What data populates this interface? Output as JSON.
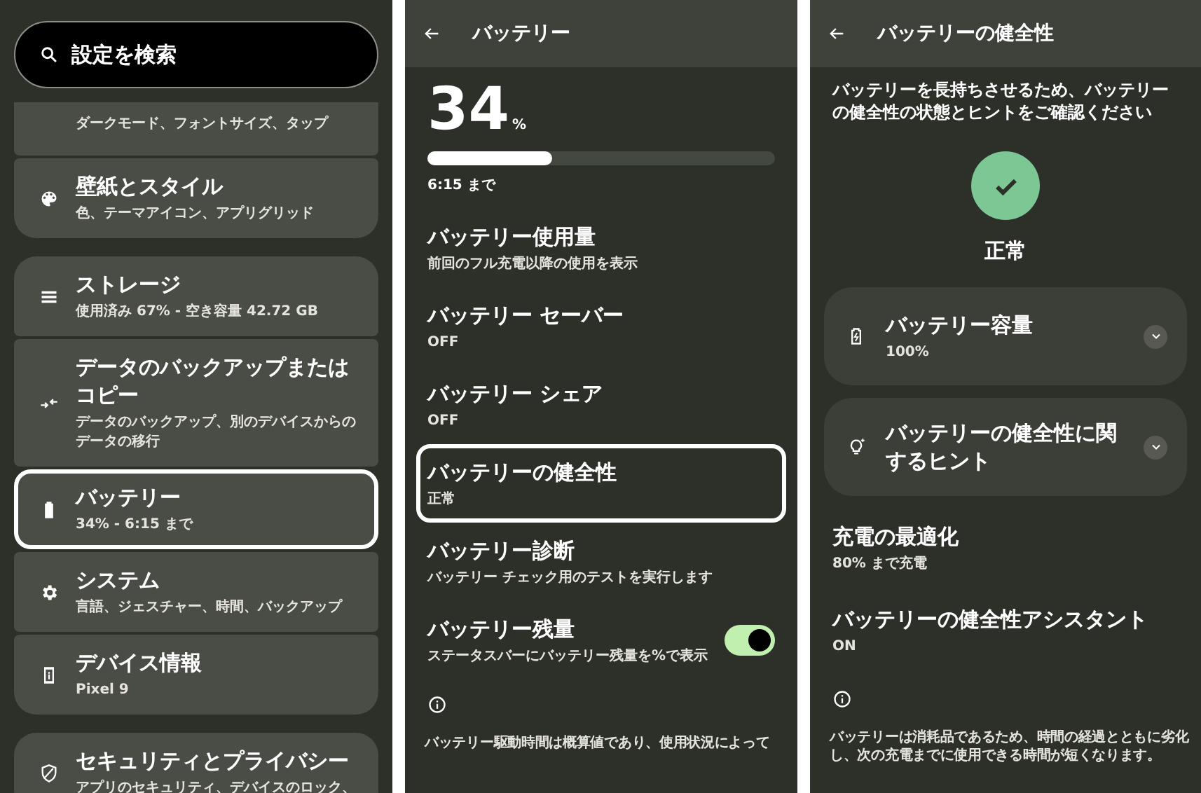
{
  "settings": {
    "search": {
      "placeholder": "設定を検索"
    },
    "groups": [
      {
        "items": [
          {
            "subtitle": "ダークモード、フォントサイズ、タップ",
            "selected": false
          },
          {
            "title": "壁紙とスタイル",
            "subtitle": "色、テーマアイコン、アプリグリッド",
            "selected": false
          }
        ]
      },
      {
        "items": [
          {
            "title": "ストレージ",
            "subtitle": "使用済み 67% - 空き容量 42.72 GB",
            "selected": false
          },
          {
            "title": "データのバックアップまたはコピー",
            "subtitle": "データのバックアップ、別のデバイスからのデータの移行",
            "selected": false
          },
          {
            "title": "バッテリー",
            "subtitle": "34% - 6:15 まで",
            "selected": true
          },
          {
            "title": "システム",
            "subtitle": "言語、ジェスチャー、時間、バックアップ",
            "selected": false
          },
          {
            "title": "デバイス情報",
            "subtitle": "Pixel 9",
            "selected": false
          }
        ]
      },
      {
        "items": [
          {
            "title": "セキュリティとプライバシー",
            "subtitle": "アプリのセキュリティ、デバイスのロック、",
            "selected": false
          }
        ]
      }
    ]
  },
  "battery": {
    "title": "バッテリー",
    "percent": "34",
    "unit": "%",
    "level": 0.36,
    "remaining": "6:15 まで",
    "items": [
      {
        "kind": "text",
        "title": "バッテリー使用量",
        "subtitle": "前回のフル充電以降の使用を表示",
        "selected": false
      },
      {
        "kind": "text",
        "title": "バッテリー セーバー",
        "subtitle": "OFF",
        "selected": false
      },
      {
        "kind": "text",
        "title": "バッテリー シェア",
        "subtitle": "OFF",
        "selected": false
      },
      {
        "kind": "text",
        "title": "バッテリーの健全性",
        "subtitle": "正常",
        "selected": true
      },
      {
        "kind": "text",
        "title": "バッテリー診断",
        "subtitle": "バッテリー チェック用のテストを実行します",
        "selected": false
      },
      {
        "kind": "switch",
        "title": "バッテリー残量",
        "subtitle": "ステータスバーにバッテリー残量を%で表示",
        "selected": false,
        "on": true
      }
    ],
    "footer": "バッテリー駆動時間は概算値であり、使用状況によって"
  },
  "health": {
    "title": "バッテリーの健全性",
    "description": "バッテリーを長持ちさせるため、バッテリーの健全性の状態とヒントをご確認ください",
    "status": "正常",
    "cards": [
      {
        "title": "バッテリー容量",
        "subtitle": "100%",
        "expanded": false
      },
      {
        "title": "バッテリーの健全性に関するヒント",
        "expanded": false
      }
    ],
    "items": [
      {
        "title": "充電の最適化",
        "subtitle": "80% まで充電"
      },
      {
        "title": "バッテリーの健全性アシスタント",
        "subtitle": "ON"
      }
    ],
    "footer": "バッテリーは消耗品であるため、時間の経過とともに劣化し、次の充電までに使用できる時間が短くなります。"
  }
}
